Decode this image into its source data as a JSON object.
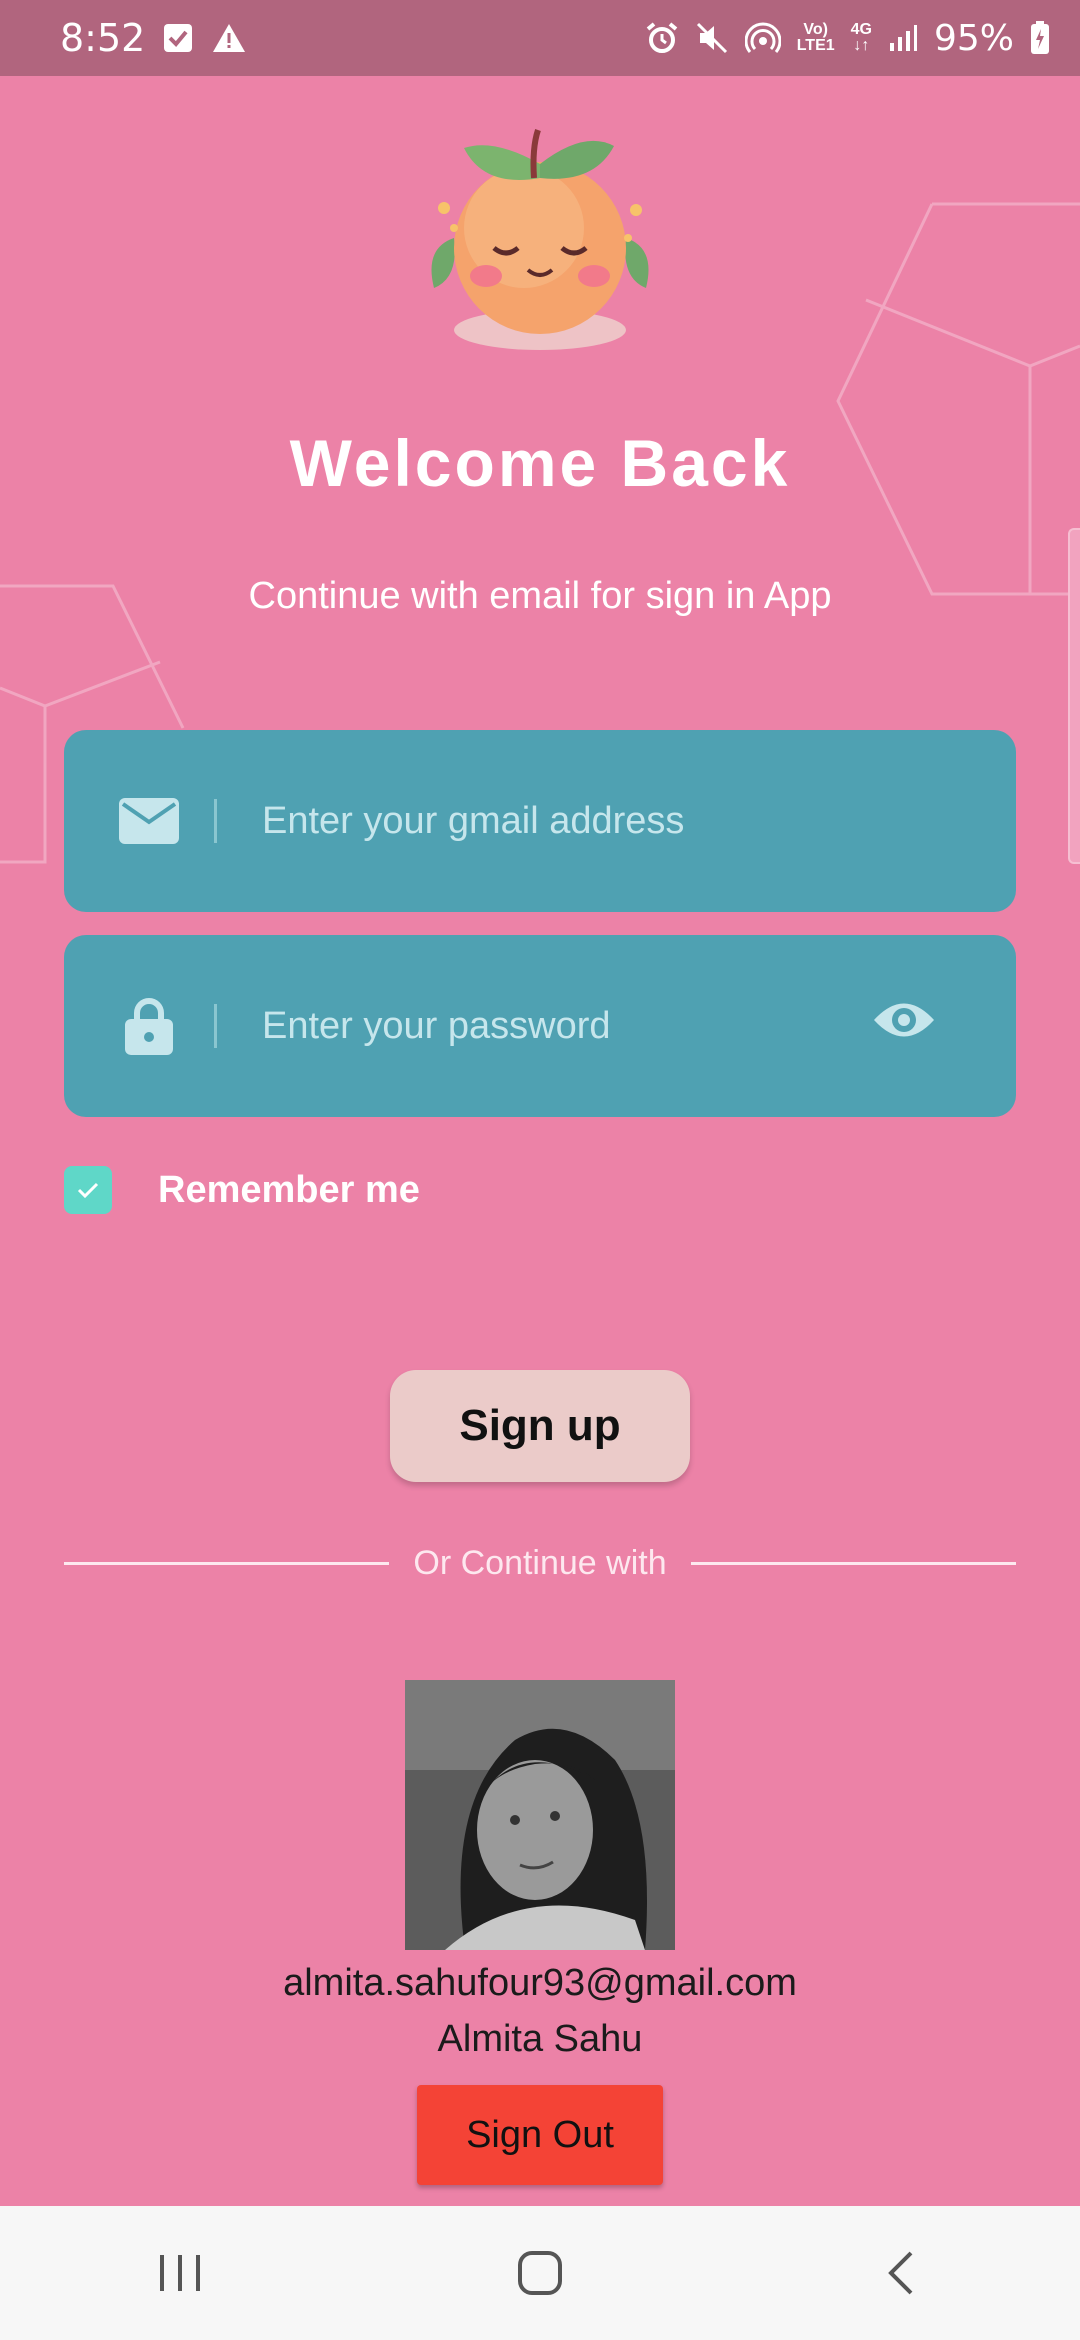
{
  "status_bar": {
    "time": "8:52",
    "network_top": "Vo)",
    "network_bottom": "LTE1",
    "network_type": "4G",
    "battery": "95%",
    "icons": [
      "checkbox-notification-icon",
      "warning-icon",
      "alarm-icon",
      "mute-icon",
      "hotspot-icon",
      "signal-icon",
      "battery-charging-icon"
    ]
  },
  "login": {
    "title": "Welcome Back",
    "subtitle": "Continue with email for sign in App",
    "email_placeholder": "Enter your gmail address",
    "password_placeholder": "Enter your password",
    "remember_label": "Remember me",
    "remember_checked": true,
    "signup_label": "Sign up",
    "divider_text": "Or Continue with"
  },
  "user": {
    "email": "almita.sahufour93@gmail.com",
    "name": "Almita Sahu",
    "signout_label": "Sign Out"
  },
  "colors": {
    "background": "#ec82a7",
    "status_bar": "#b1657e",
    "field": "#4fa1b2",
    "checkbox": "#5fd7c8",
    "signup_button": "#ebcbc9",
    "signout_button": "#f44336"
  }
}
